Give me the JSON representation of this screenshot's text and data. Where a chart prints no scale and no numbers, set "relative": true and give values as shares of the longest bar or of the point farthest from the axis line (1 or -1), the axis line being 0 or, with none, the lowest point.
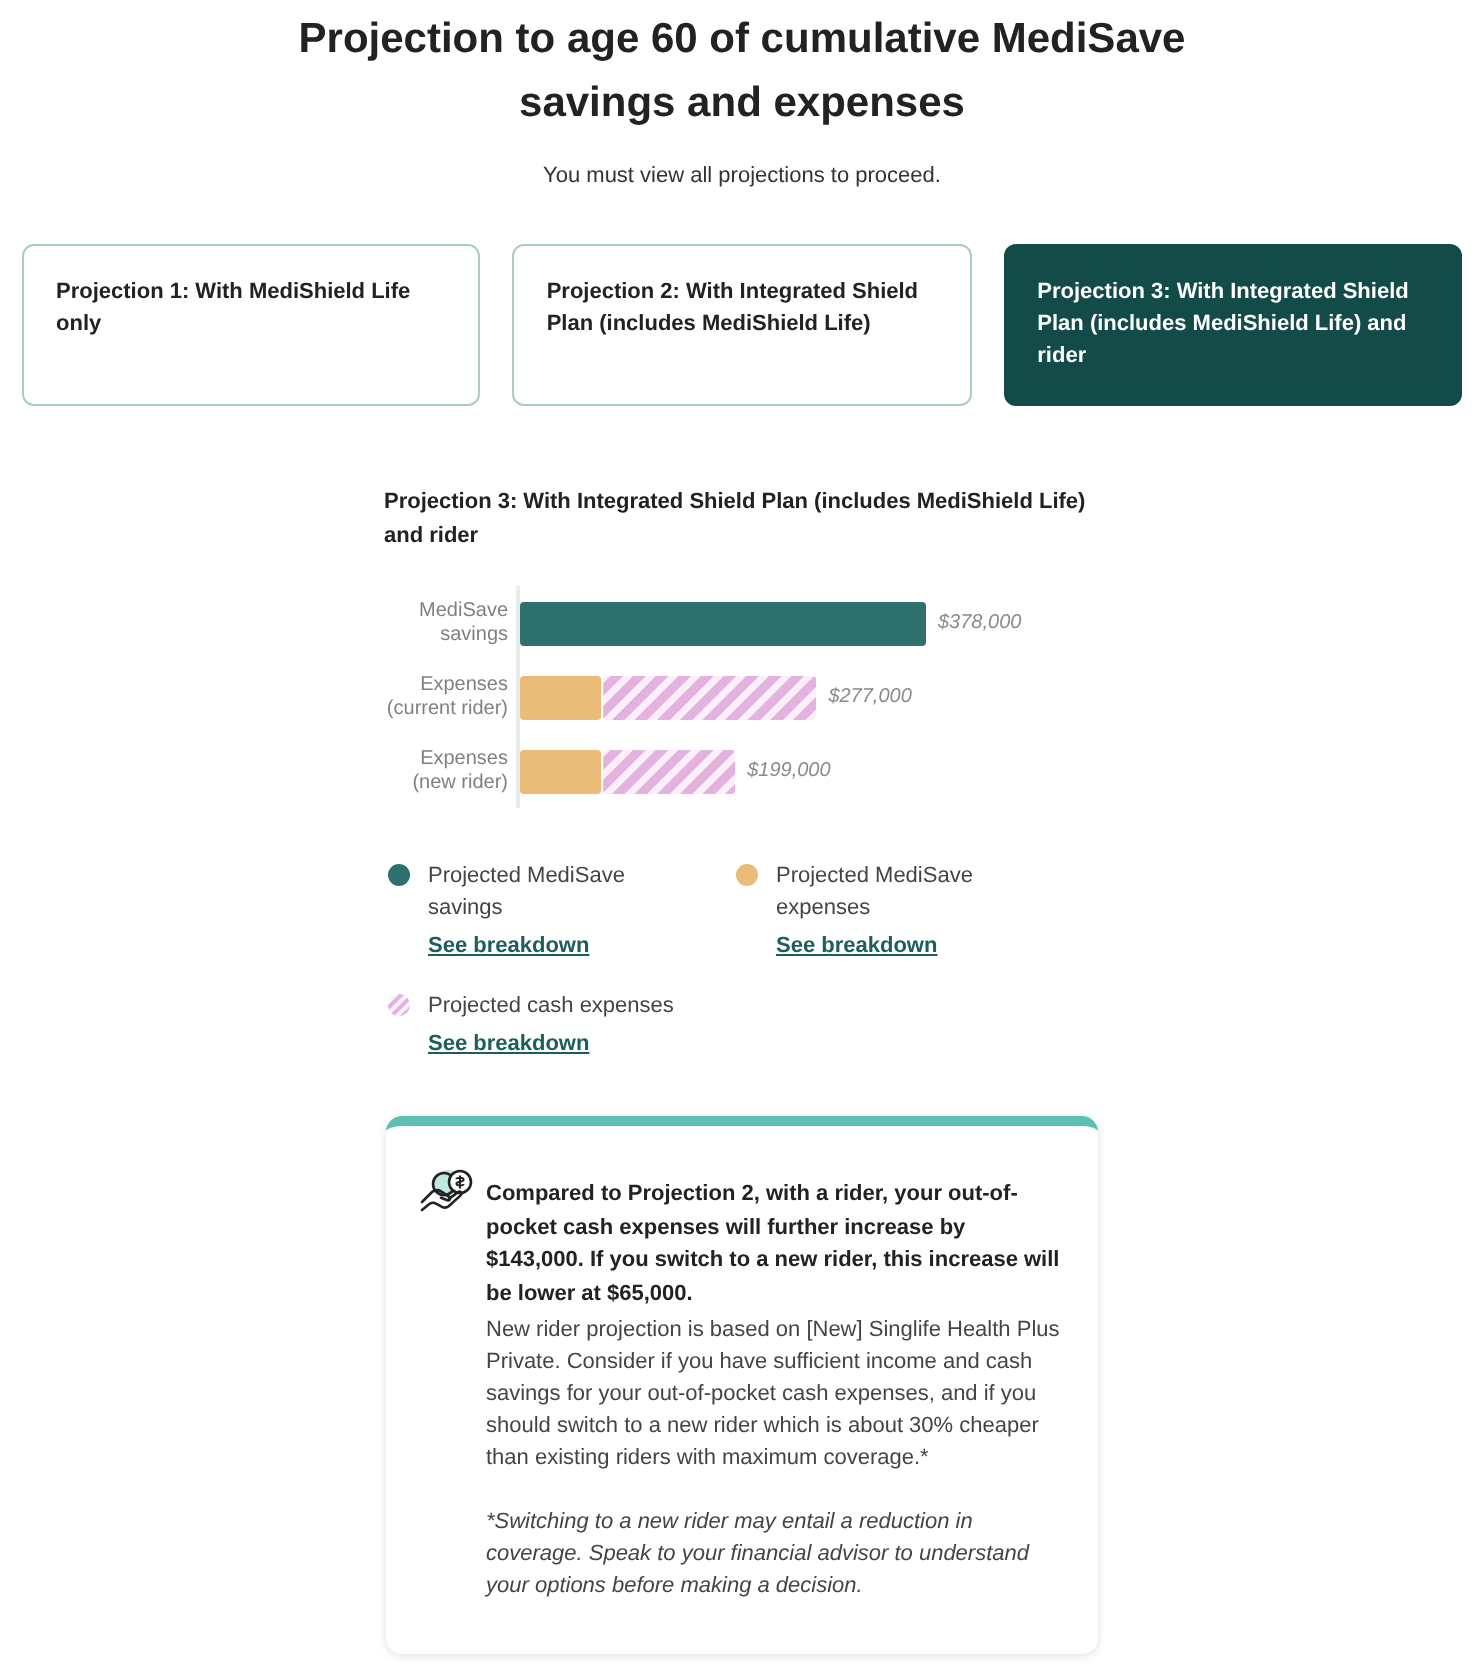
{
  "title": "Projection to age 60 of cumulative MediSave savings and expenses",
  "subtitle": "You must view all projections to proceed.",
  "tabs": [
    {
      "label": "Projection 1: With MediShield Life only",
      "selected": false
    },
    {
      "label": "Projection 2: With Integrated Shield Plan (includes MediShield Life)",
      "selected": false
    },
    {
      "label": "Projection 3: With Integrated Shield Plan (includes MediShield Life) and rider",
      "selected": true
    }
  ],
  "chart_section": {
    "heading": "Projection 3: With Integrated Shield Plan (includes MediShield Life) and rider",
    "chart_data": {
      "type": "bar",
      "orientation": "horizontal",
      "stacked": true,
      "relative": true,
      "categories": [
        "MediSave savings",
        "Expenses (current rider)",
        "Expenses (new rider)"
      ],
      "series": [
        {
          "name": "Projected MediSave savings",
          "color": "#2e706b",
          "values": [
            1,
            null,
            null
          ]
        },
        {
          "name": "Projected MediSave expenses",
          "color": "#e9bc78",
          "values": [
            null,
            0.2,
            0.2
          ]
        },
        {
          "name": "Projected cash expenses",
          "color": "#e3b2df",
          "values": [
            null,
            0.53,
            0.33
          ]
        }
      ],
      "value_labels": [
        "$378,000",
        "$277,000",
        "$199,000"
      ]
    },
    "legend": [
      {
        "kind": "solid",
        "link": "See breakdown"
      },
      {
        "kind": "solid",
        "link": "See breakdown"
      },
      {
        "kind": "striped",
        "link": "See breakdown"
      }
    ]
  },
  "info_card": {
    "heading": "Compared to Projection 2, with a rider, your out-of-pocket cash expenses will further increase by $143,000. If you switch to a new rider, this increase will be lower at $65,000.",
    "body": "New rider projection is based on [New] Singlife Health Plus Private. Consider if you have sufficient income and cash savings for your out-of-pocket cash expenses, and if you should switch to a new rider which is about 30% cheaper than existing riders with maximum coverage.*",
    "note": "*Switching to a new rider may entail a reduction in coverage. Speak to your financial advisor to understand your options before making a decision."
  }
}
